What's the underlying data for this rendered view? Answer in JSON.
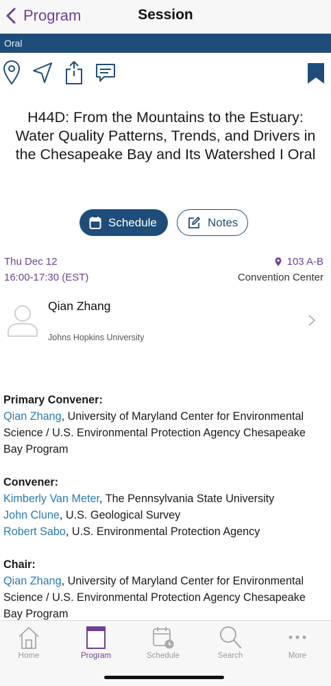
{
  "header": {
    "back_label": "Program",
    "title": "Session"
  },
  "session": {
    "type_label": "Oral",
    "title": "H44D: From the Mountains to the Estuary: Water Quality Patterns, Trends, and Drivers in the Chesapeake Bay and Its Watershed I Oral",
    "schedule_label": "Schedule",
    "notes_label": "Notes",
    "date": "Thu Dec 12",
    "time": "16:00-17:30 (EST)",
    "room": "103 A-B",
    "venue": "Convention Center"
  },
  "person": {
    "name": "Qian Zhang",
    "affiliation": "Johns Hopkins University"
  },
  "roles": {
    "primary": {
      "heading": "Primary Convener:",
      "people": [
        {
          "name": "Qian Zhang",
          "affiliation": ", University of Maryland Center for Environmental Science / U.S. Environmental Protection Agency Chesapeake Bay Program"
        }
      ]
    },
    "convener": {
      "heading": "Convener:",
      "people": [
        {
          "name": "Kimberly Van Meter",
          "affiliation": ", The Pennsylvania State University"
        },
        {
          "name": "John Clune",
          "affiliation": ", U.S. Geological Survey"
        },
        {
          "name": "Robert Sabo",
          "affiliation": ", U.S. Environmental Protection Agency"
        }
      ]
    },
    "chair": {
      "heading": "Chair:",
      "people": [
        {
          "name": "Qian Zhang",
          "affiliation": ", University of Maryland Center for Environmental Science / U.S. Environmental Protection Agency Chesapeake Bay Program"
        }
      ]
    }
  },
  "tabs": [
    {
      "label": "Home",
      "icon": "home-icon",
      "active": false
    },
    {
      "label": "Program",
      "icon": "book-icon",
      "active": true
    },
    {
      "label": "Schedule",
      "icon": "calendar-clock-icon",
      "active": false
    },
    {
      "label": "Search",
      "icon": "search-icon",
      "active": false
    },
    {
      "label": "More",
      "icon": "more-icon",
      "active": false
    }
  ],
  "colors": {
    "accent_purple": "#6f3f96",
    "brand_navy": "#1e4d7a",
    "link_blue": "#2a7ab8"
  }
}
